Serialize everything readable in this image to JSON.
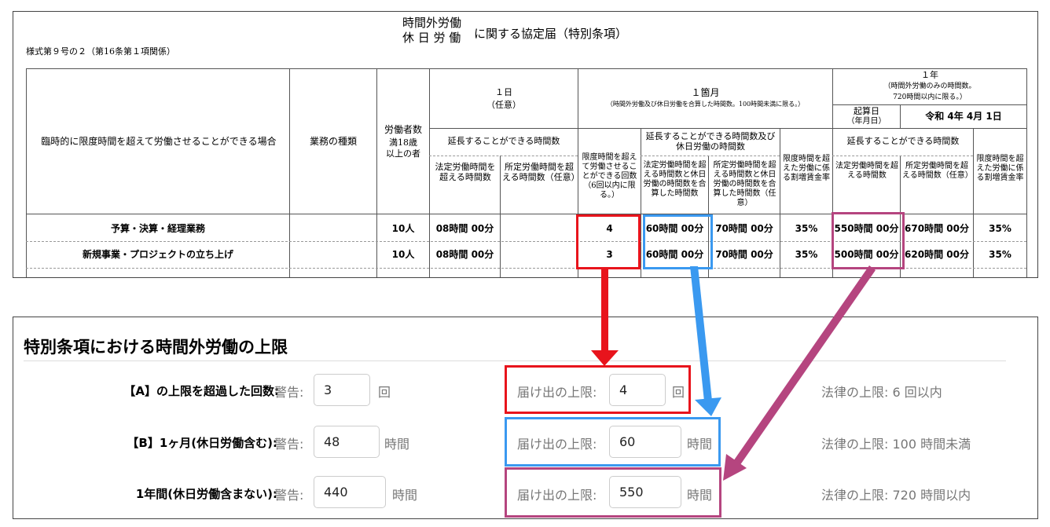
{
  "doc": {
    "title_line1": "時間外労働",
    "title_line2": "休 日 労 働",
    "title_suffix": "に関する協定届（特別条項）",
    "form_number": "様式第９号の２（第16条第１項関係）",
    "col_case": "臨時的に限度時間を超えて労働させることができる場合",
    "col_work": "業務の種類",
    "col_workers_l1": "労働者数",
    "col_workers_l2": "満18歳",
    "col_workers_l3": "以上の者",
    "day_head": "１日",
    "day_opt": "（任意）",
    "day_extend": "延長することができる時間数",
    "day_legal": "法定労働時間を超える時間数",
    "day_sched": "所定労働時間を超える時間数（任意）",
    "month_head": "１箇月",
    "month_note": "（時間外労働及び休日労働を合算した時間数。100時間未満に限る。）",
    "month_count": "限度時間を超えて労働させることができる回数（6回以内に限る。）",
    "month_extend": "延長することができる時間数及び休日労働の時間数",
    "month_legal": "法定労働時間を超える時間数と休日労働の時間数を合算した時間数",
    "month_sched": "所定労働時間を超える時間数と休日労働の時間数を合算した時間数（任意）",
    "month_rate": "限度時間を超えた労働に係る割増賃金率",
    "year_head": "１年",
    "year_note1": "（時間外労働のみの時間数。",
    "year_note2": "720時間以内に限る。）",
    "start_label1": "起算日",
    "start_label2": "（年月日）",
    "start_value": "令和 4年 4月 1日",
    "year_extend": "延長することができる時間数",
    "year_legal": "法定労働時間を超える時間数",
    "year_sched": "所定労働時間を超える時間数（任意）",
    "year_rate": "限度時間を超えた労働に係る割増賃金率",
    "rows": [
      {
        "case": "予算・決算・経理業務",
        "workers": "10人",
        "day_legal": "08時間 00分",
        "count": "4",
        "month_legal": "60時間 00分",
        "month_sched": "70時間 00分",
        "month_rate": "35%",
        "year_legal": "550時間 00分",
        "year_sched": "670時間 00分",
        "year_rate": "35%"
      },
      {
        "case": "新規事業・プロジェクトの立ち上げ",
        "workers": "10人",
        "day_legal": "08時間 00分",
        "count": "3",
        "month_legal": "60時間 00分",
        "month_sched": "70時間 00分",
        "month_rate": "35%",
        "year_legal": "500時間 00分",
        "year_sched": "620時間 00分",
        "year_rate": "35%"
      }
    ]
  },
  "form": {
    "title": "特別条項における時間外労働の上限",
    "rows": [
      {
        "label": "【A】の上限を超過した回数:",
        "warn_label": "警告:",
        "warn_value": "3",
        "warn_unit": "回",
        "limit_label": "届け出の上限:",
        "limit_value": "4",
        "limit_unit": "回",
        "law": "法律の上限: 6 回以内"
      },
      {
        "label": "【B】1ヶ月(休日労働含む):",
        "warn_label": "警告:",
        "warn_value": "48",
        "warn_unit": "時間",
        "limit_label": "届け出の上限:",
        "limit_value": "60",
        "limit_unit": "時間",
        "law": "法律の上限: 100 時間未満"
      },
      {
        "label": "1年間(休日労働含まない):",
        "warn_label": "警告:",
        "warn_value": "440",
        "warn_unit": "時間",
        "limit_label": "届け出の上限:",
        "limit_value": "550",
        "limit_unit": "時間",
        "law": "法律の上限: 720 時間以内"
      }
    ]
  },
  "colors": {
    "red": "#e8141c",
    "blue": "#3a99f0",
    "purple": "#b5457f"
  }
}
